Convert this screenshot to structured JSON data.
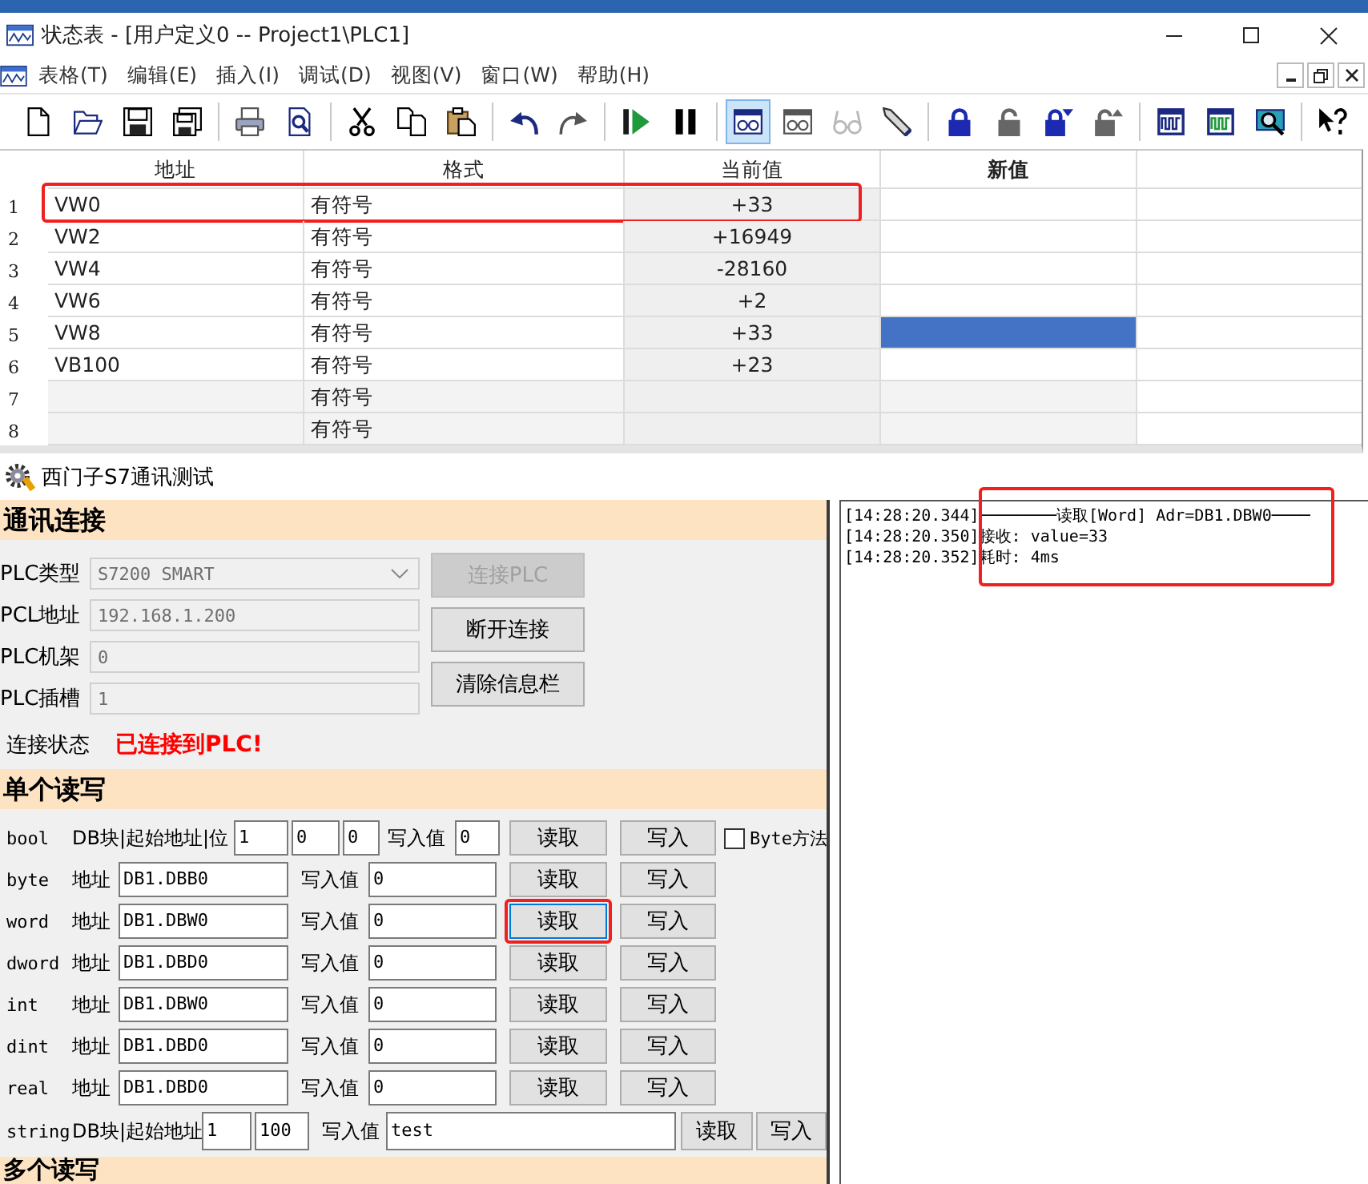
{
  "status_window": {
    "title": "状态表 - [用户定义0 -- Project1\\PLC1]",
    "menu": [
      "表格(T)",
      "编辑(E)",
      "插入(I)",
      "调试(D)",
      "视图(V)",
      "窗口(W)",
      "帮助(H)"
    ],
    "toolbar": [
      [
        {
          "kind": "new",
          "selected": false,
          "disabled": false
        },
        {
          "kind": "open",
          "selected": false,
          "disabled": false
        },
        {
          "kind": "save",
          "selected": false,
          "disabled": false
        },
        {
          "kind": "saveall",
          "selected": false,
          "disabled": false
        }
      ],
      [
        {
          "kind": "print",
          "selected": false,
          "disabled": false
        },
        {
          "kind": "preview",
          "selected": false,
          "disabled": false
        }
      ],
      [
        {
          "kind": "cut",
          "selected": false,
          "disabled": false
        },
        {
          "kind": "copy",
          "selected": false,
          "disabled": false
        },
        {
          "kind": "paste",
          "selected": false,
          "disabled": false
        }
      ],
      [
        {
          "kind": "undo",
          "selected": false,
          "disabled": false
        },
        {
          "kind": "redo",
          "selected": false,
          "disabled": false
        }
      ],
      [
        {
          "kind": "run",
          "selected": false,
          "disabled": false
        },
        {
          "kind": "pause",
          "selected": false,
          "disabled": false
        }
      ],
      [
        {
          "kind": "watch",
          "selected": true,
          "disabled": false
        },
        {
          "kind": "watchtrend",
          "selected": false,
          "disabled": false
        },
        {
          "kind": "glasses",
          "selected": false,
          "disabled": true
        },
        {
          "kind": "pencil",
          "selected": false,
          "disabled": false
        }
      ],
      [
        {
          "kind": "lock",
          "selected": false,
          "disabled": false
        },
        {
          "kind": "unlock",
          "selected": false,
          "disabled": false
        },
        {
          "kind": "lockdown",
          "selected": false,
          "disabled": false
        },
        {
          "kind": "unlockup",
          "selected": false,
          "disabled": false
        }
      ],
      [
        {
          "kind": "trend",
          "selected": false,
          "disabled": false
        },
        {
          "kind": "trend2",
          "selected": false,
          "disabled": false
        },
        {
          "kind": "inspect",
          "selected": false,
          "disabled": false
        }
      ],
      [
        {
          "kind": "help",
          "selected": false,
          "disabled": false
        }
      ]
    ],
    "table": {
      "columns": [
        {
          "label": "地址",
          "bold": false
        },
        {
          "label": "格式",
          "bold": false
        },
        {
          "label": "当前值",
          "bold": false
        },
        {
          "label": "新值",
          "bold": true
        }
      ],
      "rows": [
        {
          "index": "1",
          "address": "VW0",
          "format": "有符号",
          "current": "+33",
          "selected": false,
          "disabled": false,
          "highlighted": true
        },
        {
          "index": "2",
          "address": "VW2",
          "format": "有符号",
          "current": "+16949",
          "selected": false,
          "disabled": false,
          "highlighted": false
        },
        {
          "index": "3",
          "address": "VW4",
          "format": "有符号",
          "current": "-28160",
          "selected": false,
          "disabled": false,
          "highlighted": false
        },
        {
          "index": "4",
          "address": "VW6",
          "format": "有符号",
          "current": "+2",
          "selected": false,
          "disabled": false,
          "highlighted": false
        },
        {
          "index": "5",
          "address": "VW8",
          "format": "有符号",
          "current": "+33",
          "selected": true,
          "disabled": false,
          "highlighted": false
        },
        {
          "index": "6",
          "address": "VB100",
          "format": "有符号",
          "current": "+23",
          "selected": false,
          "disabled": false,
          "highlighted": false
        },
        {
          "index": "7",
          "format": "有符号",
          "selected": false,
          "disabled": true,
          "highlighted": false
        },
        {
          "index": "8",
          "format": "有符号",
          "selected": false,
          "disabled": true,
          "highlighted": false
        }
      ]
    }
  },
  "test_window": {
    "title": "西门子S7通讯测试",
    "connection": {
      "heading": "通讯连接",
      "fields": [
        {
          "label": "PLC类型",
          "kind": "select",
          "value": "S7200 SMART",
          "disabled": true
        },
        {
          "label": "PCL地址",
          "kind": "text",
          "value": "192.168.1.200",
          "disabled": true
        },
        {
          "label": "PLC机架",
          "kind": "text",
          "value": "0",
          "disabled": true
        },
        {
          "label": "PLC插槽",
          "kind": "text",
          "value": "1",
          "disabled": true
        }
      ],
      "buttons": [
        {
          "label": "连接PLC",
          "disabled": true
        },
        {
          "label": "断开连接",
          "disabled": false
        },
        {
          "label": "清除信息栏",
          "disabled": false
        }
      ],
      "status_label": "连接状态",
      "status": "已连接到PLC!"
    },
    "single": {
      "heading": "单个读写",
      "rows": [
        {
          "kind": "bit",
          "type": "bool",
          "label": "DB块|起始地址|位",
          "inputs": [
            "1",
            "0",
            "0"
          ],
          "write_label": "写入值",
          "write_value": "0",
          "read": "读取",
          "write": "写入",
          "highlighted": false,
          "option": {
            "label": "Byte方法",
            "checked": false
          }
        },
        {
          "kind": "address",
          "type": "byte",
          "label": "地址",
          "inputs": [
            "DB1.DBB0"
          ],
          "write_label": "写入值",
          "write_value": "0",
          "read": "读取",
          "write": "写入",
          "highlighted": false
        },
        {
          "kind": "address",
          "type": "word",
          "label": "地址",
          "inputs": [
            "DB1.DBW0"
          ],
          "write_label": "写入值",
          "write_value": "0",
          "read": "读取",
          "write": "写入",
          "highlighted": true
        },
        {
          "kind": "address",
          "type": "dword",
          "label": "地址",
          "inputs": [
            "DB1.DBD0"
          ],
          "write_label": "写入值",
          "write_value": "0",
          "read": "读取",
          "write": "写入",
          "highlighted": false
        },
        {
          "kind": "address",
          "type": "int",
          "label": "地址",
          "inputs": [
            "DB1.DBW0"
          ],
          "write_label": "写入值",
          "write_value": "0",
          "read": "读取",
          "write": "写入",
          "highlighted": false
        },
        {
          "kind": "address",
          "type": "dint",
          "label": "地址",
          "inputs": [
            "DB1.DBD0"
          ],
          "write_label": "写入值",
          "write_value": "0",
          "read": "读取",
          "write": "写入",
          "highlighted": false
        },
        {
          "kind": "address",
          "type": "real",
          "label": "地址",
          "inputs": [
            "DB1.DBD0"
          ],
          "write_label": "写入值",
          "write_value": "0",
          "read": "读取",
          "write": "写入",
          "highlighted": false
        },
        {
          "kind": "block",
          "type": "string",
          "label": "DB块|起始地址",
          "inputs": [
            "1",
            "100"
          ],
          "write_label": "写入值",
          "write_value": "test",
          "read": "读取",
          "write": "写入",
          "highlighted": false
        }
      ]
    },
    "multi": {
      "heading": "多个读写"
    },
    "log": {
      "highlighted": true,
      "lines": [
        {
          "time": "[14:28:20.344]",
          "message": "────────读取[Word] Adr=DB1.DBW0────"
        },
        {
          "time": "[14:28:20.350]",
          "message": "接收: value=33"
        },
        {
          "time": "[14:28:20.352]",
          "message": "耗时: 4ms"
        }
      ]
    }
  }
}
